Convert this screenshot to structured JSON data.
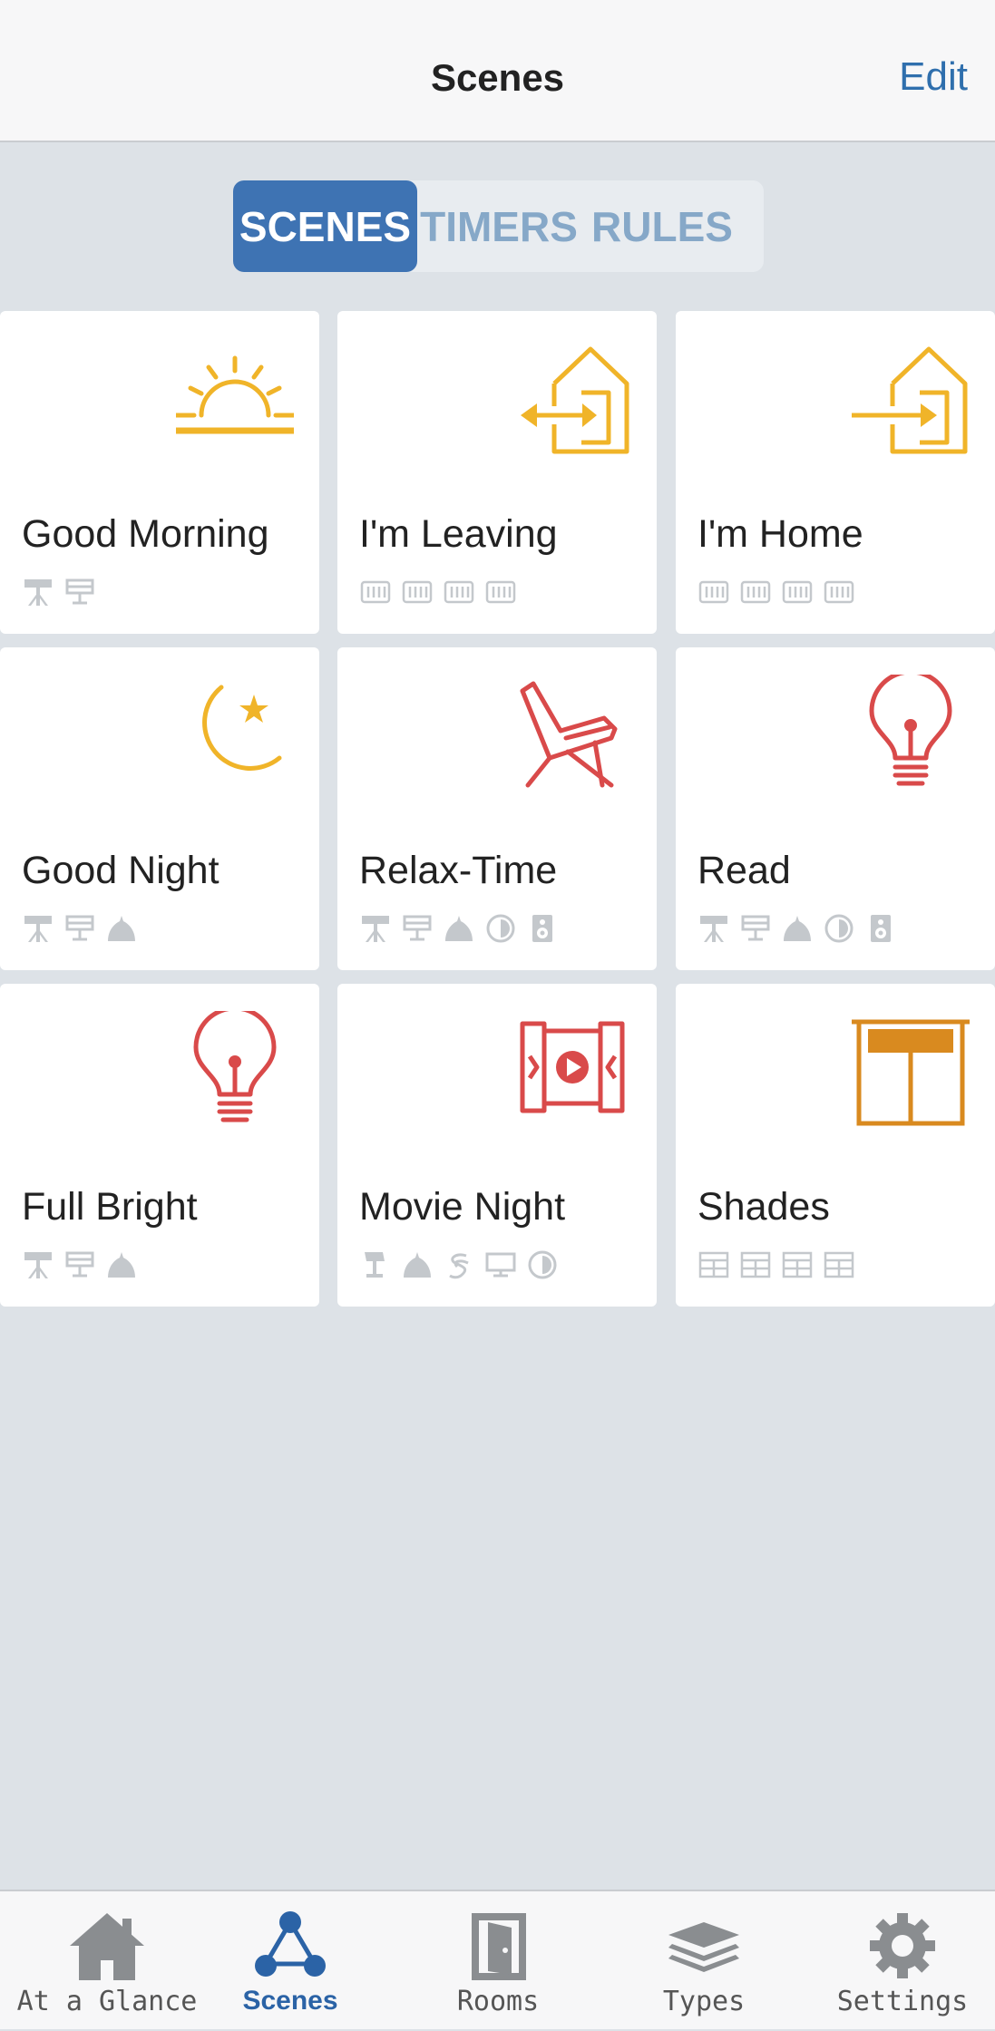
{
  "header": {
    "title": "Scenes",
    "edit_label": "Edit"
  },
  "segments": {
    "active": "SCENES",
    "items": [
      "SCENES",
      "TIMERS",
      "RULES"
    ]
  },
  "scenes": [
    {
      "name": "Good Morning",
      "icon": "sunrise-icon",
      "icon_color": "#f0b429",
      "devices": [
        "floor-lamp-icon",
        "ceiling-light-icon"
      ]
    },
    {
      "name": "I'm Leaving",
      "icon": "house-exit-icon",
      "icon_color": "#f0b429",
      "devices": [
        "radiator-icon",
        "radiator-icon",
        "radiator-icon",
        "radiator-icon"
      ]
    },
    {
      "name": "I'm Home",
      "icon": "house-enter-icon",
      "icon_color": "#f0b429",
      "devices": [
        "radiator-icon",
        "radiator-icon",
        "radiator-icon",
        "radiator-icon"
      ]
    },
    {
      "name": "Good Night",
      "icon": "moon-star-icon",
      "icon_color": "#f0b429",
      "devices": [
        "floor-lamp-icon",
        "ceiling-light-icon",
        "pendant-lamp-icon"
      ]
    },
    {
      "name": "Relax-Time",
      "icon": "lounge-chair-icon",
      "icon_color": "#d94a4a",
      "devices": [
        "floor-lamp-icon",
        "ceiling-light-icon",
        "pendant-lamp-icon",
        "dimmer-icon",
        "speaker-icon"
      ]
    },
    {
      "name": "Read",
      "icon": "light-bulb-icon",
      "icon_color": "#d94a4a",
      "devices": [
        "floor-lamp-icon",
        "ceiling-light-icon",
        "pendant-lamp-icon",
        "dimmer-icon",
        "speaker-icon"
      ]
    },
    {
      "name": "Full Bright",
      "icon": "light-bulb-icon",
      "icon_color": "#d94a4a",
      "devices": [
        "floor-lamp-icon",
        "ceiling-light-icon",
        "pendant-lamp-icon"
      ]
    },
    {
      "name": "Movie Night",
      "icon": "movie-screen-icon",
      "icon_color": "#d94a4a",
      "devices": [
        "table-lamp-icon",
        "pendant-lamp-icon",
        "fan-icon",
        "tv-icon",
        "dimmer-icon"
      ]
    },
    {
      "name": "Shades",
      "icon": "window-shade-icon",
      "icon_color": "#d98a1f",
      "devices": [
        "shade-icon",
        "shade-icon",
        "shade-icon",
        "shade-icon"
      ]
    }
  ],
  "tabbar": {
    "items": [
      {
        "label": "At a Glance",
        "icon": "house-icon"
      },
      {
        "label": "Scenes",
        "icon": "scenes-icon",
        "active": true
      },
      {
        "label": "Rooms",
        "icon": "door-icon"
      },
      {
        "label": "Types",
        "icon": "layers-icon"
      },
      {
        "label": "Settings",
        "icon": "gear-icon"
      }
    ]
  },
  "colors": {
    "accent": "#3e73b3",
    "background": "#dde2e7",
    "device_icon": "#c4c8cc"
  }
}
